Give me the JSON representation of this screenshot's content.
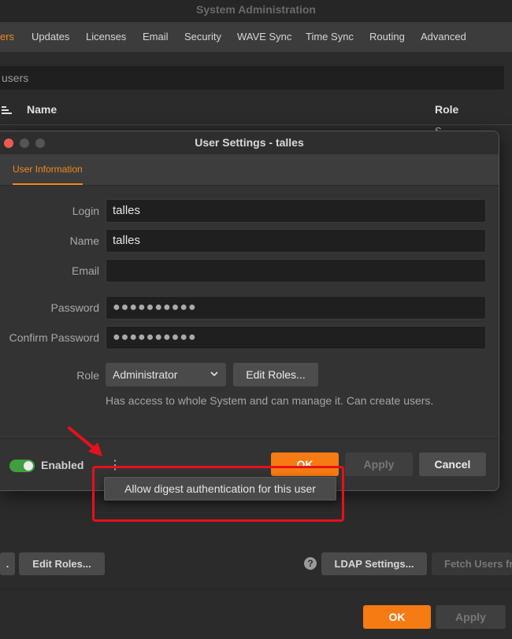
{
  "background_window": {
    "title": "System Administration",
    "tabs": [
      {
        "label": "ers"
      },
      {
        "label": "Updates"
      },
      {
        "label": "Licenses"
      },
      {
        "label": "Email"
      },
      {
        "label": "Security"
      },
      {
        "label": "WAVE Sync"
      },
      {
        "label": "Time Sync"
      },
      {
        "label": "Routing"
      },
      {
        "label": "Advanced"
      }
    ],
    "search_text": "users",
    "columns": {
      "name": "Name",
      "role": "Role"
    },
    "partial_row_text": "S",
    "buttons": {
      "partial_left": ".",
      "edit_roles": "Edit Roles...",
      "ldap_settings": "LDAP Settings...",
      "fetch_users": "Fetch Users fr"
    },
    "help_glyph": "?",
    "footer": {
      "ok": "OK",
      "apply": "Apply"
    }
  },
  "dialog": {
    "title": "User Settings - talles",
    "tab": "User Information",
    "fields": {
      "login_label": "Login",
      "login_value": "talles",
      "name_label": "Name",
      "name_value": "talles",
      "email_label": "Email",
      "email_value": "",
      "password_label": "Password",
      "password_value": "●●●●●●●●●●",
      "confirm_label": "Confirm Password",
      "confirm_value": "●●●●●●●●●●"
    },
    "role": {
      "label": "Role",
      "selected": "Administrator",
      "edit_button": "Edit Roles...",
      "description": "Has access to whole System and can manage it. Can create users."
    },
    "enabled_label": "Enabled",
    "enabled": true,
    "more_glyph": "⋮",
    "buttons": {
      "ok": "OK",
      "apply": "Apply",
      "cancel": "Cancel"
    }
  },
  "popup_menu": {
    "item": "Allow digest authentication for this user"
  },
  "colors": {
    "accent": "#f67b13",
    "tab_active": "#f08a1c",
    "annotation": "#e8101a",
    "toggle_on": "#3f9f3f"
  }
}
